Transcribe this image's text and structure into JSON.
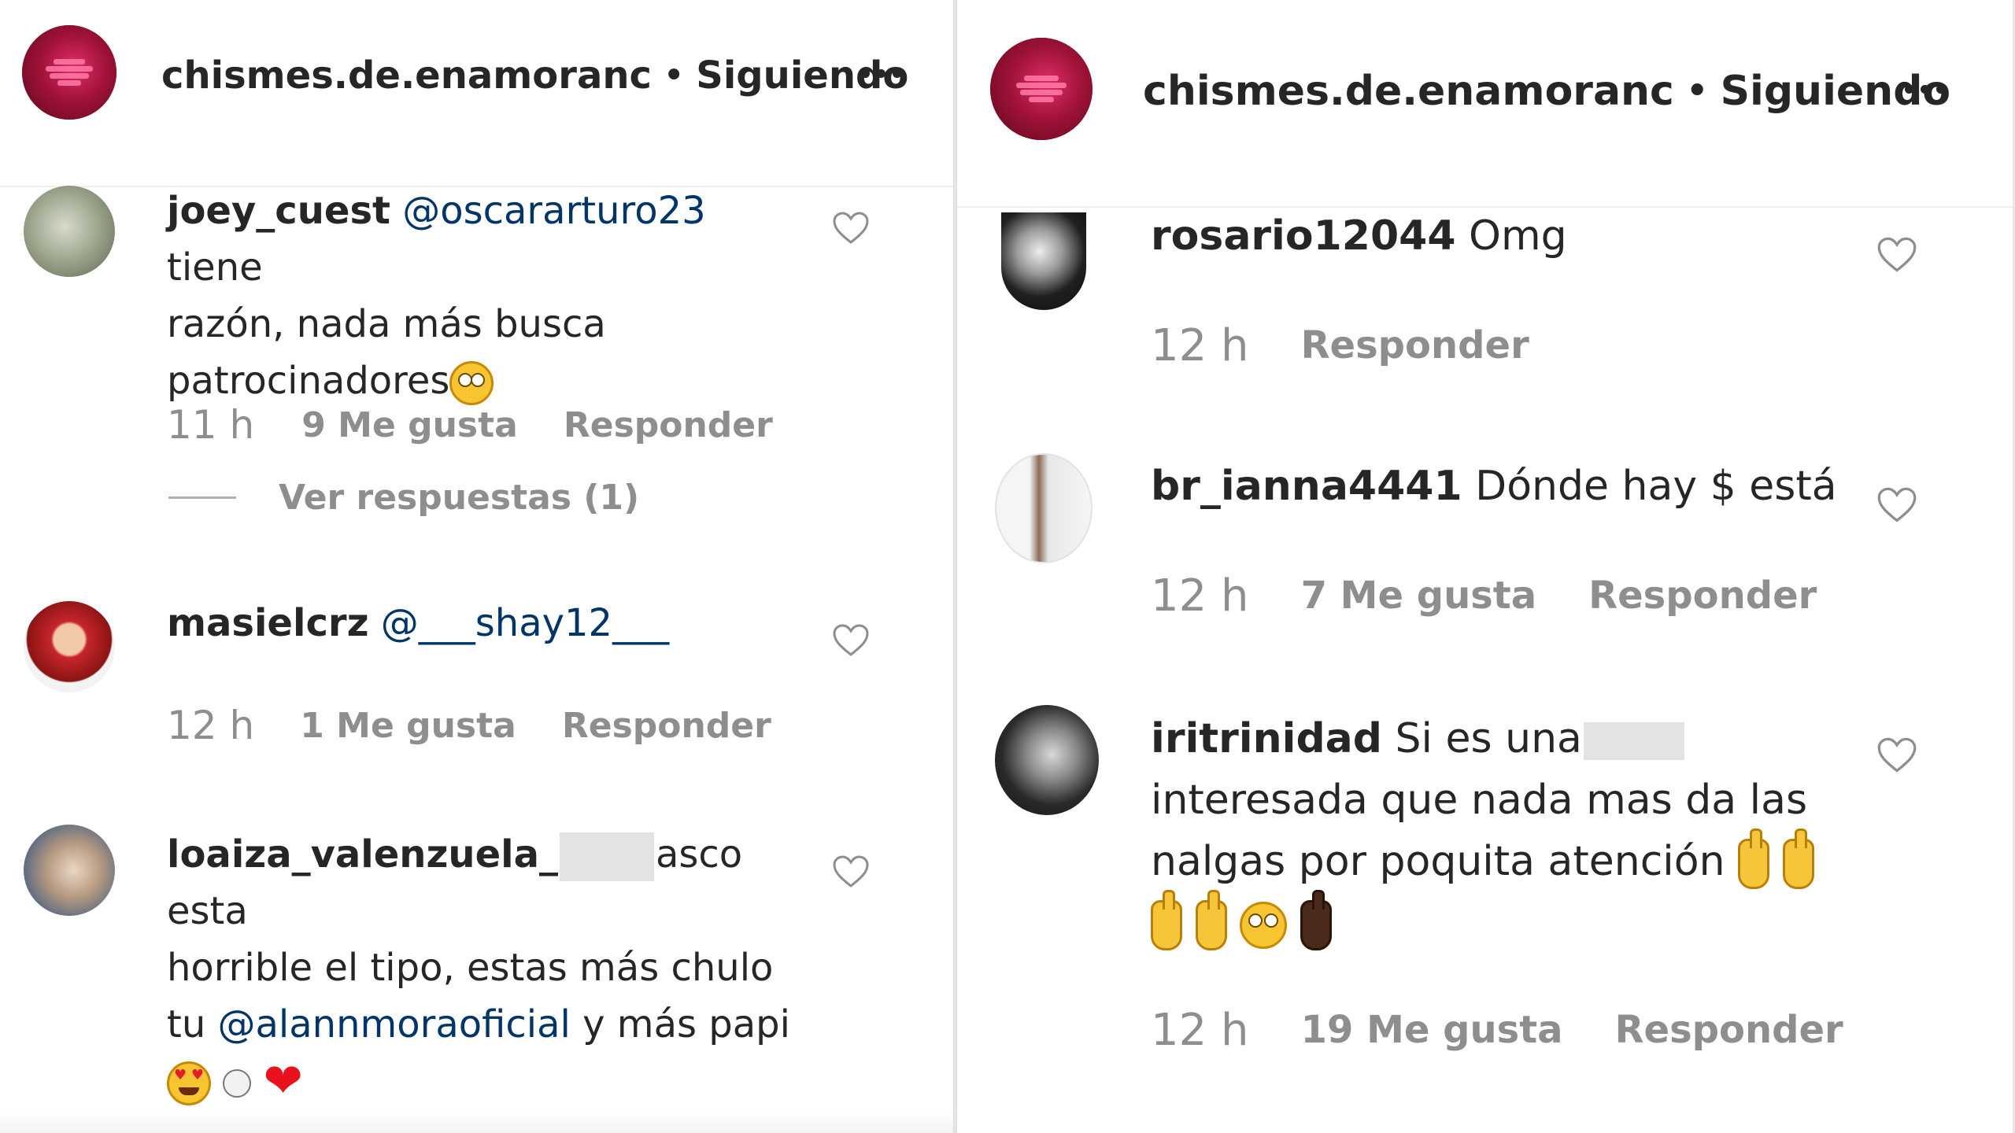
{
  "left": {
    "header": {
      "username": "chismes.de.enamoranc",
      "separator": "•",
      "follow_status": "Siguiendo"
    },
    "comments": [
      {
        "username": "joey_cuest",
        "mention": "@oscararturo23",
        "text_line1_tail": "tiene",
        "text_line2": "razón, nada más busca",
        "text_line3": "patrocinadores",
        "time": "11 h",
        "likes": "9 Me gusta",
        "reply": "Responder",
        "view_replies": "Ver respuestas (1)"
      },
      {
        "username": "masielcrz",
        "mention": "@___shay12___",
        "time": "12 h",
        "likes": "1 Me gusta",
        "reply": "Responder"
      },
      {
        "username": "loaiza_valenzuela_",
        "text_line1_tail": "asco esta",
        "text_line2": "horrible el tipo, estas más chulo",
        "text_line3_pre": "tu",
        "mention": "@alannmoraoficial",
        "text_line3_post": "y más papi"
      }
    ]
  },
  "right": {
    "header": {
      "username": "chismes.de.enamoranc",
      "separator": "•",
      "follow_status": "Siguiendo"
    },
    "comments": [
      {
        "username": "rosario12044",
        "text": "Omg",
        "time": "12 h",
        "reply": "Responder"
      },
      {
        "username": "br_ianna4441",
        "text": "Dónde hay $ está",
        "time": "12 h",
        "likes": "7 Me gusta",
        "reply": "Responder"
      },
      {
        "username": "iritrinidad",
        "text_line1": "Si es una",
        "text_line2": "interesada que nada mas da las",
        "text_line3": "nalgas por poquita atención",
        "time": "12 h",
        "likes": "19 Me gusta",
        "reply": "Responder"
      }
    ]
  },
  "colors": {
    "text": "#262626",
    "meta": "#8e8e8e",
    "mention": "#003569",
    "divider": "#efefef",
    "avatar_brand": "#a01238"
  },
  "icons": {
    "more": "more-options-icon",
    "like": "heart-outline-icon"
  }
}
